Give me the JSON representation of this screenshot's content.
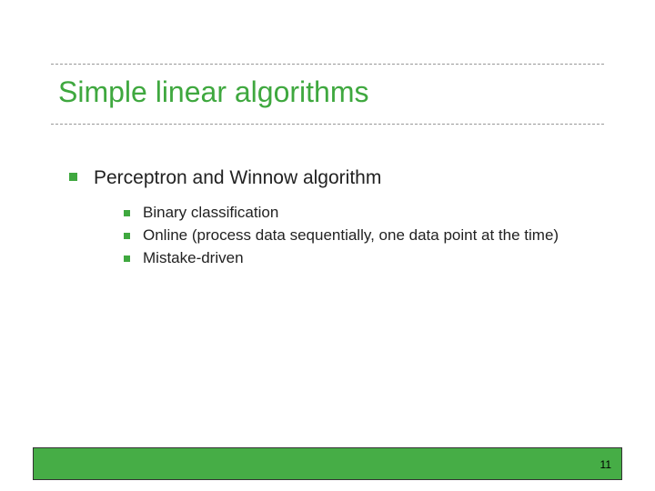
{
  "title": "Simple linear algorithms",
  "main_point": "Perceptron and Winnow algorithm",
  "sub_points": {
    "a": "Binary classification",
    "b": "Online (process data sequentially, one data point at the time)",
    "c": "Mistake-driven"
  },
  "page_number": "11"
}
